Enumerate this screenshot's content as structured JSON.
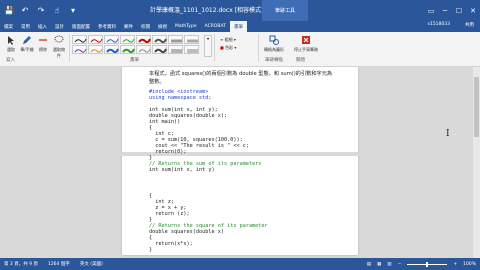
{
  "titlebar": {
    "title": "計學康概溫_1101_1012.docx [相容模式] - Word",
    "context_group": "筆跡工具",
    "min": "─",
    "max": "☐",
    "close": "✕",
    "restore": "▭"
  },
  "qat": {
    "save": "💾",
    "undo": "↶",
    "redo": "↷",
    "touch": "☝",
    "more": "▾"
  },
  "tabs": [
    "檔案",
    "常用",
    "插入",
    "設計",
    "版面配置",
    "參考資料",
    "郵件",
    "校閱",
    "檢視",
    "MathType",
    "ACROBAT",
    "畫筆"
  ],
  "active_tab": "畫筆",
  "user": "s1518033",
  "share": "共用",
  "ribbon": {
    "tools": [
      "選取",
      "筆/手繪",
      "擦除",
      "選取物件"
    ],
    "group_write": "寫入",
    "group_pens": "畫筆",
    "thickness": "粗細",
    "color": "色彩",
    "group_close": "關閉",
    "convert": "轉換為圖形",
    "stop_ink": "停止手寫筆跡",
    "ink_to_shape": "筆跡轉換",
    "close_label": "關閉"
  },
  "document": {
    "para1": "本程式，函式 squares()的兩個引數為 double 型態，和 sum()的引數和字元為",
    "para2": "整數。",
    "code_page1": [
      {
        "cls": "kw",
        "text": "#include <iostream>"
      },
      {
        "cls": "kw",
        "text": "using namespace std;"
      },
      {
        "cls": "tx",
        "text": ""
      },
      {
        "cls": "tx",
        "text": "int sum(int x, int y);"
      },
      {
        "cls": "tx",
        "text": "double squares(double x);"
      },
      {
        "cls": "tx",
        "text": "int main()"
      },
      {
        "cls": "tx",
        "text": "{"
      },
      {
        "cls": "tx",
        "text": "  int c;"
      },
      {
        "cls": "tx",
        "text": "  c = sum(10, squares(100.0));"
      },
      {
        "cls": "tx",
        "text": "  cout << \"The result is \" << c;"
      },
      {
        "cls": "tx",
        "text": "  return(0);"
      },
      {
        "cls": "tx",
        "text": "}"
      },
      {
        "cls": "cm",
        "text": "// Returns the sum of its parameters"
      },
      {
        "cls": "tx",
        "text": "int sum(int x, int y)"
      }
    ],
    "code_page2": [
      {
        "cls": "tx",
        "text": "{"
      },
      {
        "cls": "tx",
        "text": "  int z;"
      },
      {
        "cls": "tx",
        "text": "  z = x + y;"
      },
      {
        "cls": "tx",
        "text": "  return (z);"
      },
      {
        "cls": "tx",
        "text": "}"
      },
      {
        "cls": "cm",
        "text": "// Returns the square of its parameter"
      },
      {
        "cls": "tx",
        "text": "double squares(double x)"
      },
      {
        "cls": "tx",
        "text": "{"
      },
      {
        "cls": "tx",
        "text": "  return(x*x);"
      },
      {
        "cls": "tx",
        "text": "}"
      }
    ]
  },
  "status": {
    "page": "第 3 頁，共 9 頁",
    "words": "1264 個字",
    "lang": "英文 (美國)",
    "zoom": "100%"
  },
  "colors": {
    "accent": "#2b579a",
    "keyword": "#1f3fd0",
    "comment": "#2d8a2d"
  }
}
